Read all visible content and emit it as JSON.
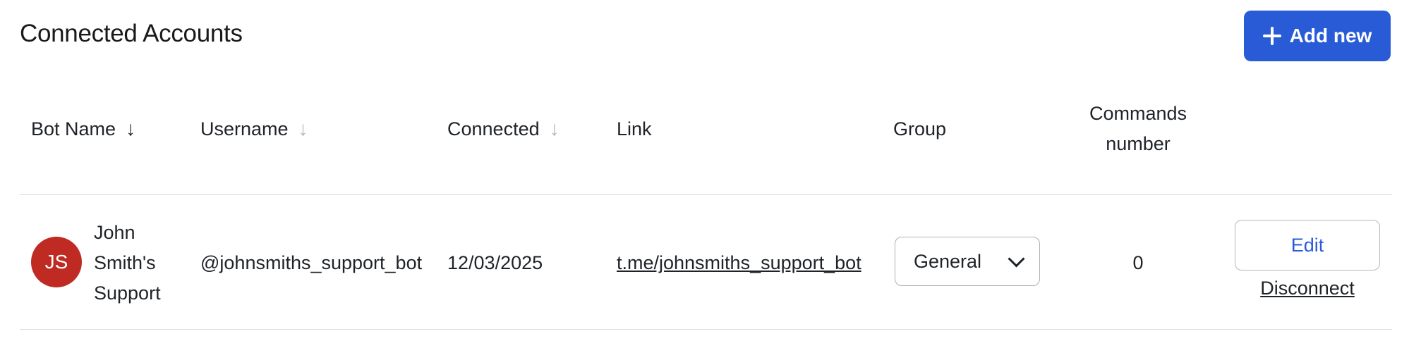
{
  "header": {
    "title": "Connected Accounts",
    "add_button_label": "Add new",
    "add_button_icon": "plus-icon",
    "accent_color": "#2a5bd7"
  },
  "table": {
    "columns": {
      "bot_name": "Bot Name",
      "username": "Username",
      "connected": "Connected",
      "link": "Link",
      "group": "Group",
      "commands_line1": "Commands",
      "commands_line2": "number"
    },
    "sort_icons": {
      "bot_name": "arrow-down-icon (active)",
      "username": "arrow-down-icon (inactive)",
      "connected": "arrow-down-icon (inactive)"
    },
    "rows": [
      {
        "avatar_initials": "JS",
        "avatar_color": "#bf2a22",
        "bot_name": "John Smith's Support",
        "username": "@johnsmiths_support_bot",
        "connected": "12/03/2025",
        "link": "t.me/johnsmiths_support_bot",
        "group": "General",
        "commands": "0",
        "edit_label": "Edit",
        "disconnect_label": "Disconnect"
      }
    ]
  }
}
